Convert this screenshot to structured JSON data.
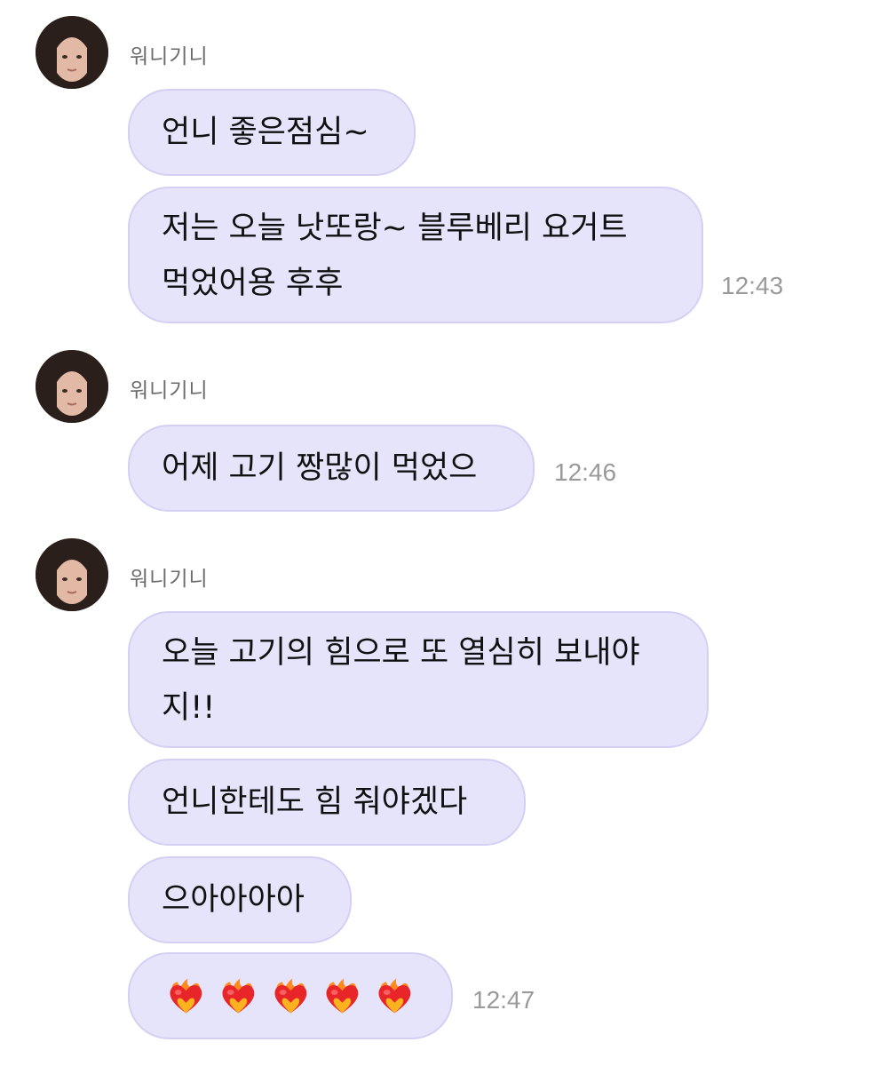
{
  "chat": {
    "groups": [
      {
        "sender": "워니기니",
        "messages": [
          {
            "text": "언니 좋은점심~"
          },
          {
            "lines": [
              "저는 오늘 낫또랑~ 블루베리 요거트",
              "먹었어용 후후"
            ]
          }
        ],
        "time": "12:43"
      },
      {
        "sender": "워니기니",
        "messages": [
          {
            "text": "어제 고기 짱많이 먹었으"
          }
        ],
        "time": "12:46"
      },
      {
        "sender": "워니기니",
        "messages": [
          {
            "lines": [
              "오늘 고기의 힘으로 또 열심히 보내야",
              "지!!"
            ]
          },
          {
            "text": "언니한테도 힘 줘야겠다"
          },
          {
            "text": "으아아아아"
          },
          {
            "emoji": "heart-on-fire",
            "count": 5
          }
        ],
        "time": "12:47"
      }
    ]
  },
  "colors": {
    "bubble": "#e6e4fb",
    "bubble_border": "#d3d0f4",
    "time": "#9a9a9a",
    "sender": "#6b6b6b"
  }
}
